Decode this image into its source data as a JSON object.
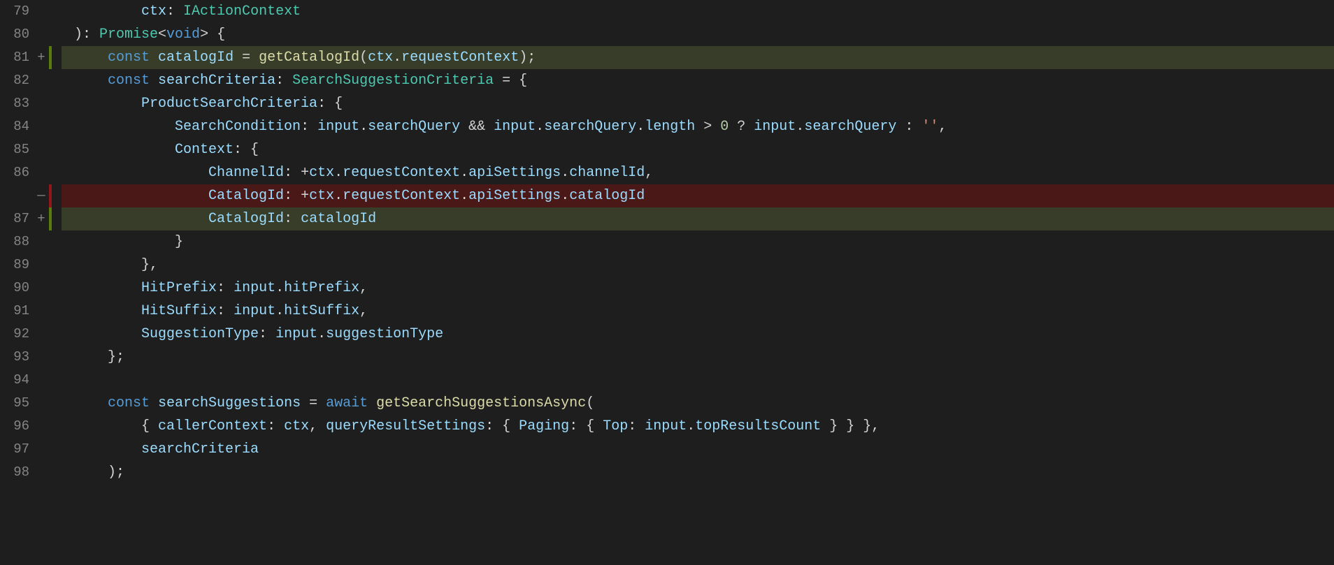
{
  "lines": [
    {
      "num": "79",
      "diff": "",
      "indent": 2,
      "bg": "",
      "tokens": [
        {
          "t": "var",
          "s": "ctx"
        },
        {
          "t": "punct",
          "s": ": "
        },
        {
          "t": "type",
          "s": "IActionContext"
        }
      ]
    },
    {
      "num": "80",
      "diff": "",
      "indent": 0,
      "bg": "",
      "tokens": [
        {
          "t": "punct",
          "s": "): "
        },
        {
          "t": "type",
          "s": "Promise"
        },
        {
          "t": "punct",
          "s": "<"
        },
        {
          "t": "kw",
          "s": "void"
        },
        {
          "t": "punct",
          "s": "> {"
        }
      ]
    },
    {
      "num": "81",
      "diff": "+",
      "indent": 1,
      "bg": "add",
      "tokens": [
        {
          "t": "kw",
          "s": "const"
        },
        {
          "t": "op",
          "s": " "
        },
        {
          "t": "var",
          "s": "catalogId"
        },
        {
          "t": "op",
          "s": " = "
        },
        {
          "t": "fn",
          "s": "getCatalogId"
        },
        {
          "t": "punct",
          "s": "("
        },
        {
          "t": "var",
          "s": "ctx"
        },
        {
          "t": "punct",
          "s": "."
        },
        {
          "t": "var",
          "s": "requestContext"
        },
        {
          "t": "punct",
          "s": ");"
        }
      ]
    },
    {
      "num": "82",
      "diff": "",
      "indent": 1,
      "bg": "",
      "tokens": [
        {
          "t": "kw",
          "s": "const"
        },
        {
          "t": "op",
          "s": " "
        },
        {
          "t": "var",
          "s": "searchCriteria"
        },
        {
          "t": "punct",
          "s": ": "
        },
        {
          "t": "type",
          "s": "SearchSuggestionCriteria"
        },
        {
          "t": "op",
          "s": " = "
        },
        {
          "t": "punct",
          "s": "{"
        }
      ]
    },
    {
      "num": "83",
      "diff": "",
      "indent": 2,
      "bg": "",
      "tokens": [
        {
          "t": "var",
          "s": "ProductSearchCriteria"
        },
        {
          "t": "punct",
          "s": ": {"
        }
      ]
    },
    {
      "num": "84",
      "diff": "",
      "indent": 3,
      "bg": "",
      "tokens": [
        {
          "t": "var",
          "s": "SearchCondition"
        },
        {
          "t": "punct",
          "s": ": "
        },
        {
          "t": "var",
          "s": "input"
        },
        {
          "t": "punct",
          "s": "."
        },
        {
          "t": "var",
          "s": "searchQuery"
        },
        {
          "t": "op",
          "s": " && "
        },
        {
          "t": "var",
          "s": "input"
        },
        {
          "t": "punct",
          "s": "."
        },
        {
          "t": "var",
          "s": "searchQuery"
        },
        {
          "t": "punct",
          "s": "."
        },
        {
          "t": "var",
          "s": "length"
        },
        {
          "t": "op",
          "s": " > "
        },
        {
          "t": "num",
          "s": "0"
        },
        {
          "t": "op",
          "s": " ? "
        },
        {
          "t": "var",
          "s": "input"
        },
        {
          "t": "punct",
          "s": "."
        },
        {
          "t": "var",
          "s": "searchQuery"
        },
        {
          "t": "op",
          "s": " : "
        },
        {
          "t": "str",
          "s": "''"
        },
        {
          "t": "punct",
          "s": ","
        }
      ]
    },
    {
      "num": "85",
      "diff": "",
      "indent": 3,
      "bg": "",
      "tokens": [
        {
          "t": "var",
          "s": "Context"
        },
        {
          "t": "punct",
          "s": ": {"
        }
      ]
    },
    {
      "num": "86",
      "diff": "",
      "indent": 4,
      "bg": "",
      "tokens": [
        {
          "t": "var",
          "s": "ChannelId"
        },
        {
          "t": "punct",
          "s": ": +"
        },
        {
          "t": "var",
          "s": "ctx"
        },
        {
          "t": "punct",
          "s": "."
        },
        {
          "t": "var",
          "s": "requestContext"
        },
        {
          "t": "punct",
          "s": "."
        },
        {
          "t": "var",
          "s": "apiSettings"
        },
        {
          "t": "punct",
          "s": "."
        },
        {
          "t": "var",
          "s": "channelId"
        },
        {
          "t": "punct",
          "s": ","
        }
      ]
    },
    {
      "num": "",
      "diff": "—",
      "indent": 4,
      "bg": "del",
      "tokens": [
        {
          "t": "var",
          "s": "CatalogId"
        },
        {
          "t": "punct",
          "s": ": +"
        },
        {
          "t": "var",
          "s": "ctx"
        },
        {
          "t": "punct",
          "s": "."
        },
        {
          "t": "var",
          "s": "requestContext"
        },
        {
          "t": "punct",
          "s": "."
        },
        {
          "t": "var",
          "s": "apiSettings"
        },
        {
          "t": "punct",
          "s": "."
        },
        {
          "t": "var",
          "s": "catalogId"
        }
      ]
    },
    {
      "num": "87",
      "diff": "+",
      "indent": 4,
      "bg": "add",
      "tokens": [
        {
          "t": "var",
          "s": "CatalogId"
        },
        {
          "t": "punct",
          "s": ": "
        },
        {
          "t": "var",
          "s": "catalogId"
        }
      ]
    },
    {
      "num": "88",
      "diff": "",
      "indent": 3,
      "bg": "",
      "tokens": [
        {
          "t": "punct",
          "s": "}"
        }
      ]
    },
    {
      "num": "89",
      "diff": "",
      "indent": 2,
      "bg": "",
      "tokens": [
        {
          "t": "punct",
          "s": "},"
        }
      ]
    },
    {
      "num": "90",
      "diff": "",
      "indent": 2,
      "bg": "",
      "tokens": [
        {
          "t": "var",
          "s": "HitPrefix"
        },
        {
          "t": "punct",
          "s": ": "
        },
        {
          "t": "var",
          "s": "input"
        },
        {
          "t": "punct",
          "s": "."
        },
        {
          "t": "var",
          "s": "hitPrefix"
        },
        {
          "t": "punct",
          "s": ","
        }
      ]
    },
    {
      "num": "91",
      "diff": "",
      "indent": 2,
      "bg": "",
      "tokens": [
        {
          "t": "var",
          "s": "HitSuffix"
        },
        {
          "t": "punct",
          "s": ": "
        },
        {
          "t": "var",
          "s": "input"
        },
        {
          "t": "punct",
          "s": "."
        },
        {
          "t": "var",
          "s": "hitSuffix"
        },
        {
          "t": "punct",
          "s": ","
        }
      ]
    },
    {
      "num": "92",
      "diff": "",
      "indent": 2,
      "bg": "",
      "tokens": [
        {
          "t": "var",
          "s": "SuggestionType"
        },
        {
          "t": "punct",
          "s": ": "
        },
        {
          "t": "var",
          "s": "input"
        },
        {
          "t": "punct",
          "s": "."
        },
        {
          "t": "var",
          "s": "suggestionType"
        }
      ]
    },
    {
      "num": "93",
      "diff": "",
      "indent": 1,
      "bg": "",
      "tokens": [
        {
          "t": "punct",
          "s": "};"
        }
      ]
    },
    {
      "num": "94",
      "diff": "",
      "indent": 0,
      "bg": "",
      "tokens": []
    },
    {
      "num": "95",
      "diff": "",
      "indent": 1,
      "bg": "",
      "tokens": [
        {
          "t": "kw",
          "s": "const"
        },
        {
          "t": "op",
          "s": " "
        },
        {
          "t": "var",
          "s": "searchSuggestions"
        },
        {
          "t": "op",
          "s": " = "
        },
        {
          "t": "kw",
          "s": "await"
        },
        {
          "t": "op",
          "s": " "
        },
        {
          "t": "fn",
          "s": "getSearchSuggestionsAsync"
        },
        {
          "t": "punct",
          "s": "("
        }
      ]
    },
    {
      "num": "96",
      "diff": "",
      "indent": 2,
      "bg": "",
      "tokens": [
        {
          "t": "punct",
          "s": "{ "
        },
        {
          "t": "var",
          "s": "callerContext"
        },
        {
          "t": "punct",
          "s": ": "
        },
        {
          "t": "var",
          "s": "ctx"
        },
        {
          "t": "punct",
          "s": ", "
        },
        {
          "t": "var",
          "s": "queryResultSettings"
        },
        {
          "t": "punct",
          "s": ": { "
        },
        {
          "t": "var",
          "s": "Paging"
        },
        {
          "t": "punct",
          "s": ": { "
        },
        {
          "t": "var",
          "s": "Top"
        },
        {
          "t": "punct",
          "s": ": "
        },
        {
          "t": "var",
          "s": "input"
        },
        {
          "t": "punct",
          "s": "."
        },
        {
          "t": "var",
          "s": "topResultsCount"
        },
        {
          "t": "punct",
          "s": " } } },"
        }
      ]
    },
    {
      "num": "97",
      "diff": "",
      "indent": 2,
      "bg": "",
      "tokens": [
        {
          "t": "var",
          "s": "searchCriteria"
        }
      ]
    },
    {
      "num": "98",
      "diff": "",
      "indent": 1,
      "bg": "",
      "tokens": [
        {
          "t": "punct",
          "s": ");"
        }
      ]
    }
  ]
}
